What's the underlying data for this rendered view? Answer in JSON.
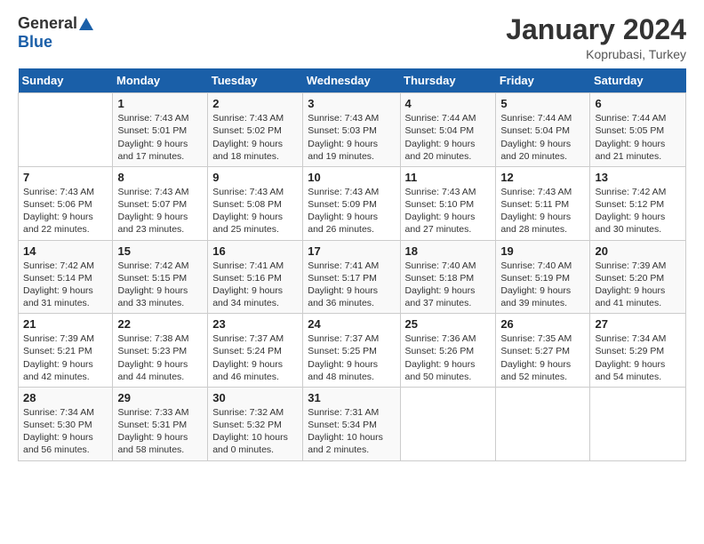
{
  "logo": {
    "general": "General",
    "blue": "Blue"
  },
  "title": "January 2024",
  "subtitle": "Koprubasi, Turkey",
  "headers": [
    "Sunday",
    "Monday",
    "Tuesday",
    "Wednesday",
    "Thursday",
    "Friday",
    "Saturday"
  ],
  "weeks": [
    [
      {
        "day": "",
        "info": ""
      },
      {
        "day": "1",
        "info": "Sunrise: 7:43 AM\nSunset: 5:01 PM\nDaylight: 9 hours\nand 17 minutes."
      },
      {
        "day": "2",
        "info": "Sunrise: 7:43 AM\nSunset: 5:02 PM\nDaylight: 9 hours\nand 18 minutes."
      },
      {
        "day": "3",
        "info": "Sunrise: 7:43 AM\nSunset: 5:03 PM\nDaylight: 9 hours\nand 19 minutes."
      },
      {
        "day": "4",
        "info": "Sunrise: 7:44 AM\nSunset: 5:04 PM\nDaylight: 9 hours\nand 20 minutes."
      },
      {
        "day": "5",
        "info": "Sunrise: 7:44 AM\nSunset: 5:04 PM\nDaylight: 9 hours\nand 20 minutes."
      },
      {
        "day": "6",
        "info": "Sunrise: 7:44 AM\nSunset: 5:05 PM\nDaylight: 9 hours\nand 21 minutes."
      }
    ],
    [
      {
        "day": "7",
        "info": "Sunrise: 7:43 AM\nSunset: 5:06 PM\nDaylight: 9 hours\nand 22 minutes."
      },
      {
        "day": "8",
        "info": "Sunrise: 7:43 AM\nSunset: 5:07 PM\nDaylight: 9 hours\nand 23 minutes."
      },
      {
        "day": "9",
        "info": "Sunrise: 7:43 AM\nSunset: 5:08 PM\nDaylight: 9 hours\nand 25 minutes."
      },
      {
        "day": "10",
        "info": "Sunrise: 7:43 AM\nSunset: 5:09 PM\nDaylight: 9 hours\nand 26 minutes."
      },
      {
        "day": "11",
        "info": "Sunrise: 7:43 AM\nSunset: 5:10 PM\nDaylight: 9 hours\nand 27 minutes."
      },
      {
        "day": "12",
        "info": "Sunrise: 7:43 AM\nSunset: 5:11 PM\nDaylight: 9 hours\nand 28 minutes."
      },
      {
        "day": "13",
        "info": "Sunrise: 7:42 AM\nSunset: 5:12 PM\nDaylight: 9 hours\nand 30 minutes."
      }
    ],
    [
      {
        "day": "14",
        "info": "Sunrise: 7:42 AM\nSunset: 5:14 PM\nDaylight: 9 hours\nand 31 minutes."
      },
      {
        "day": "15",
        "info": "Sunrise: 7:42 AM\nSunset: 5:15 PM\nDaylight: 9 hours\nand 33 minutes."
      },
      {
        "day": "16",
        "info": "Sunrise: 7:41 AM\nSunset: 5:16 PM\nDaylight: 9 hours\nand 34 minutes."
      },
      {
        "day": "17",
        "info": "Sunrise: 7:41 AM\nSunset: 5:17 PM\nDaylight: 9 hours\nand 36 minutes."
      },
      {
        "day": "18",
        "info": "Sunrise: 7:40 AM\nSunset: 5:18 PM\nDaylight: 9 hours\nand 37 minutes."
      },
      {
        "day": "19",
        "info": "Sunrise: 7:40 AM\nSunset: 5:19 PM\nDaylight: 9 hours\nand 39 minutes."
      },
      {
        "day": "20",
        "info": "Sunrise: 7:39 AM\nSunset: 5:20 PM\nDaylight: 9 hours\nand 41 minutes."
      }
    ],
    [
      {
        "day": "21",
        "info": "Sunrise: 7:39 AM\nSunset: 5:21 PM\nDaylight: 9 hours\nand 42 minutes."
      },
      {
        "day": "22",
        "info": "Sunrise: 7:38 AM\nSunset: 5:23 PM\nDaylight: 9 hours\nand 44 minutes."
      },
      {
        "day": "23",
        "info": "Sunrise: 7:37 AM\nSunset: 5:24 PM\nDaylight: 9 hours\nand 46 minutes."
      },
      {
        "day": "24",
        "info": "Sunrise: 7:37 AM\nSunset: 5:25 PM\nDaylight: 9 hours\nand 48 minutes."
      },
      {
        "day": "25",
        "info": "Sunrise: 7:36 AM\nSunset: 5:26 PM\nDaylight: 9 hours\nand 50 minutes."
      },
      {
        "day": "26",
        "info": "Sunrise: 7:35 AM\nSunset: 5:27 PM\nDaylight: 9 hours\nand 52 minutes."
      },
      {
        "day": "27",
        "info": "Sunrise: 7:34 AM\nSunset: 5:29 PM\nDaylight: 9 hours\nand 54 minutes."
      }
    ],
    [
      {
        "day": "28",
        "info": "Sunrise: 7:34 AM\nSunset: 5:30 PM\nDaylight: 9 hours\nand 56 minutes."
      },
      {
        "day": "29",
        "info": "Sunrise: 7:33 AM\nSunset: 5:31 PM\nDaylight: 9 hours\nand 58 minutes."
      },
      {
        "day": "30",
        "info": "Sunrise: 7:32 AM\nSunset: 5:32 PM\nDaylight: 10 hours\nand 0 minutes."
      },
      {
        "day": "31",
        "info": "Sunrise: 7:31 AM\nSunset: 5:34 PM\nDaylight: 10 hours\nand 2 minutes."
      },
      {
        "day": "",
        "info": ""
      },
      {
        "day": "",
        "info": ""
      },
      {
        "day": "",
        "info": ""
      }
    ]
  ]
}
